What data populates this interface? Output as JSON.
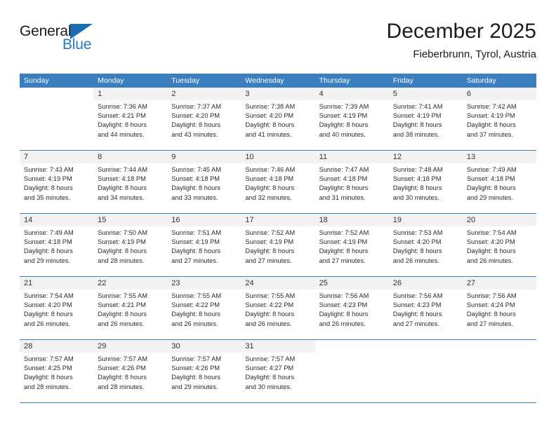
{
  "brand": {
    "name_part1": "General",
    "name_part2": "Blue",
    "logo_icon": "triangle-logo-icon",
    "accent_color": "#1b6cb3",
    "text_color": "#2a7ac0"
  },
  "header": {
    "title": "December 2025",
    "location": "Fieberbrunn, Tyrol, Austria"
  },
  "calendar": {
    "header_bg_color": "#3c7fc0",
    "day_num_bg_color": "#f2f2f2",
    "weekday_headers": [
      "Sunday",
      "Monday",
      "Tuesday",
      "Wednesday",
      "Thursday",
      "Friday",
      "Saturday"
    ],
    "weeks": [
      [
        {
          "day": "",
          "lines": []
        },
        {
          "day": "1",
          "lines": [
            "Sunrise: 7:36 AM",
            "Sunset: 4:21 PM",
            "Daylight: 8 hours",
            "and 44 minutes."
          ]
        },
        {
          "day": "2",
          "lines": [
            "Sunrise: 7:37 AM",
            "Sunset: 4:20 PM",
            "Daylight: 8 hours",
            "and 43 minutes."
          ]
        },
        {
          "day": "3",
          "lines": [
            "Sunrise: 7:38 AM",
            "Sunset: 4:20 PM",
            "Daylight: 8 hours",
            "and 41 minutes."
          ]
        },
        {
          "day": "4",
          "lines": [
            "Sunrise: 7:39 AM",
            "Sunset: 4:19 PM",
            "Daylight: 8 hours",
            "and 40 minutes."
          ]
        },
        {
          "day": "5",
          "lines": [
            "Sunrise: 7:41 AM",
            "Sunset: 4:19 PM",
            "Daylight: 8 hours",
            "and 38 minutes."
          ]
        },
        {
          "day": "6",
          "lines": [
            "Sunrise: 7:42 AM",
            "Sunset: 4:19 PM",
            "Daylight: 8 hours",
            "and 37 minutes."
          ]
        }
      ],
      [
        {
          "day": "7",
          "lines": [
            "Sunrise: 7:43 AM",
            "Sunset: 4:19 PM",
            "Daylight: 8 hours",
            "and 35 minutes."
          ]
        },
        {
          "day": "8",
          "lines": [
            "Sunrise: 7:44 AM",
            "Sunset: 4:18 PM",
            "Daylight: 8 hours",
            "and 34 minutes."
          ]
        },
        {
          "day": "9",
          "lines": [
            "Sunrise: 7:45 AM",
            "Sunset: 4:18 PM",
            "Daylight: 8 hours",
            "and 33 minutes."
          ]
        },
        {
          "day": "10",
          "lines": [
            "Sunrise: 7:46 AM",
            "Sunset: 4:18 PM",
            "Daylight: 8 hours",
            "and 32 minutes."
          ]
        },
        {
          "day": "11",
          "lines": [
            "Sunrise: 7:47 AM",
            "Sunset: 4:18 PM",
            "Daylight: 8 hours",
            "and 31 minutes."
          ]
        },
        {
          "day": "12",
          "lines": [
            "Sunrise: 7:48 AM",
            "Sunset: 4:18 PM",
            "Daylight: 8 hours",
            "and 30 minutes."
          ]
        },
        {
          "day": "13",
          "lines": [
            "Sunrise: 7:49 AM",
            "Sunset: 4:18 PM",
            "Daylight: 8 hours",
            "and 29 minutes."
          ]
        }
      ],
      [
        {
          "day": "14",
          "lines": [
            "Sunrise: 7:49 AM",
            "Sunset: 4:18 PM",
            "Daylight: 8 hours",
            "and 29 minutes."
          ]
        },
        {
          "day": "15",
          "lines": [
            "Sunrise: 7:50 AM",
            "Sunset: 4:19 PM",
            "Daylight: 8 hours",
            "and 28 minutes."
          ]
        },
        {
          "day": "16",
          "lines": [
            "Sunrise: 7:51 AM",
            "Sunset: 4:19 PM",
            "Daylight: 8 hours",
            "and 27 minutes."
          ]
        },
        {
          "day": "17",
          "lines": [
            "Sunrise: 7:52 AM",
            "Sunset: 4:19 PM",
            "Daylight: 8 hours",
            "and 27 minutes."
          ]
        },
        {
          "day": "18",
          "lines": [
            "Sunrise: 7:52 AM",
            "Sunset: 4:19 PM",
            "Daylight: 8 hours",
            "and 27 minutes."
          ]
        },
        {
          "day": "19",
          "lines": [
            "Sunrise: 7:53 AM",
            "Sunset: 4:20 PM",
            "Daylight: 8 hours",
            "and 26 minutes."
          ]
        },
        {
          "day": "20",
          "lines": [
            "Sunrise: 7:54 AM",
            "Sunset: 4:20 PM",
            "Daylight: 8 hours",
            "and 26 minutes."
          ]
        }
      ],
      [
        {
          "day": "21",
          "lines": [
            "Sunrise: 7:54 AM",
            "Sunset: 4:20 PM",
            "Daylight: 8 hours",
            "and 26 minutes."
          ]
        },
        {
          "day": "22",
          "lines": [
            "Sunrise: 7:55 AM",
            "Sunset: 4:21 PM",
            "Daylight: 8 hours",
            "and 26 minutes."
          ]
        },
        {
          "day": "23",
          "lines": [
            "Sunrise: 7:55 AM",
            "Sunset: 4:22 PM",
            "Daylight: 8 hours",
            "and 26 minutes."
          ]
        },
        {
          "day": "24",
          "lines": [
            "Sunrise: 7:55 AM",
            "Sunset: 4:22 PM",
            "Daylight: 8 hours",
            "and 26 minutes."
          ]
        },
        {
          "day": "25",
          "lines": [
            "Sunrise: 7:56 AM",
            "Sunset: 4:23 PM",
            "Daylight: 8 hours",
            "and 26 minutes."
          ]
        },
        {
          "day": "26",
          "lines": [
            "Sunrise: 7:56 AM",
            "Sunset: 4:23 PM",
            "Daylight: 8 hours",
            "and 27 minutes."
          ]
        },
        {
          "day": "27",
          "lines": [
            "Sunrise: 7:56 AM",
            "Sunset: 4:24 PM",
            "Daylight: 8 hours",
            "and 27 minutes."
          ]
        }
      ],
      [
        {
          "day": "28",
          "lines": [
            "Sunrise: 7:57 AM",
            "Sunset: 4:25 PM",
            "Daylight: 8 hours",
            "and 28 minutes."
          ]
        },
        {
          "day": "29",
          "lines": [
            "Sunrise: 7:57 AM",
            "Sunset: 4:26 PM",
            "Daylight: 8 hours",
            "and 28 minutes."
          ]
        },
        {
          "day": "30",
          "lines": [
            "Sunrise: 7:57 AM",
            "Sunset: 4:26 PM",
            "Daylight: 8 hours",
            "and 29 minutes."
          ]
        },
        {
          "day": "31",
          "lines": [
            "Sunrise: 7:57 AM",
            "Sunset: 4:27 PM",
            "Daylight: 8 hours",
            "and 30 minutes."
          ]
        },
        {
          "day": "",
          "lines": []
        },
        {
          "day": "",
          "lines": []
        },
        {
          "day": "",
          "lines": []
        }
      ]
    ]
  }
}
